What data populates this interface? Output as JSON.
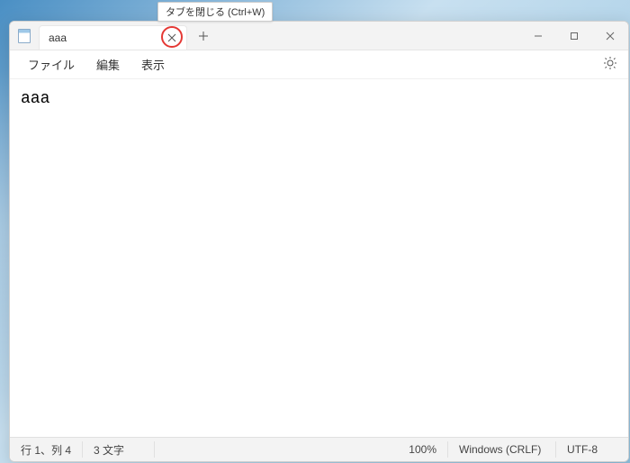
{
  "tooltip": {
    "text": "タブを閉じる (Ctrl+W)"
  },
  "tab": {
    "title": "aaa"
  },
  "menu": {
    "file": "ファイル",
    "edit": "編集",
    "view": "表示"
  },
  "editor": {
    "content": "aaa"
  },
  "statusbar": {
    "position": "行 1、列 4",
    "chars": "3 文字",
    "zoom": "100%",
    "line_ending": "Windows (CRLF)",
    "encoding": "UTF-8"
  }
}
